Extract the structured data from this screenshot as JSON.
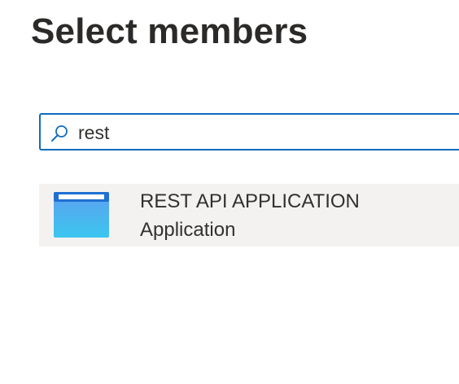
{
  "panel": {
    "title": "Select members"
  },
  "search": {
    "value": "rest",
    "icon": "search-icon"
  },
  "results": [
    {
      "name": "REST API APPLICATION",
      "type": "Application",
      "icon": "application-icon"
    }
  ],
  "colors": {
    "accent": "#0f6cbd",
    "row_background": "#f3f2f1",
    "text": "#323130"
  }
}
